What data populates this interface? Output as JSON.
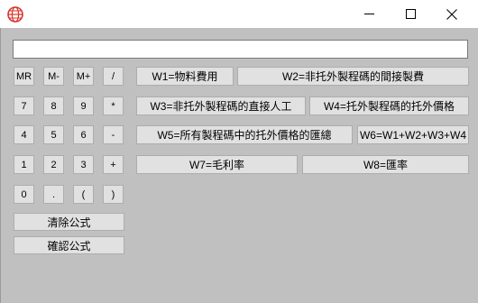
{
  "window": {
    "minimize_glyph": "—",
    "maximize_glyph": "☐",
    "close_glyph": "✕"
  },
  "formula": {
    "value": ""
  },
  "keypad": {
    "row1": [
      "MR",
      "M-",
      "M+",
      "/"
    ],
    "row2": [
      "7",
      "8",
      "9",
      "*"
    ],
    "row3": [
      "4",
      "5",
      "6",
      "-"
    ],
    "row4": [
      "1",
      "2",
      "3",
      "+"
    ],
    "row5": [
      "0",
      ".",
      "(",
      ")"
    ]
  },
  "actions": {
    "clear": "清除公式",
    "confirm": "確認公式"
  },
  "variables": {
    "w1": "W1=物料費用",
    "w2": "W2=非托外製程碼的間接製費",
    "w3": "W3=非托外製程碼的直接人工",
    "w4": "W4=托外製程碼的托外價格",
    "w5": "W5=所有製程碼中的托外價格的匯總",
    "w6": "W6=W1+W2+W3+W4",
    "w7": "W7=毛利率",
    "w8": "W8=匯率"
  },
  "colors": {
    "window_bg": "#c0c0c0",
    "button_bg": "#e1e1e1",
    "button_border": "#adadad",
    "titlebar_bg": "#ffffff"
  }
}
